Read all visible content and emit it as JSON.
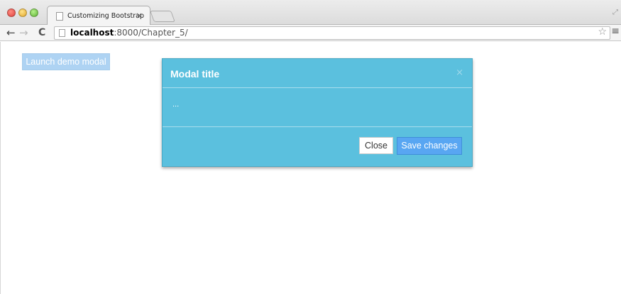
{
  "browser": {
    "tab_title": "Customizing Bootstrap",
    "tab_close": "×",
    "url_host": "localhost",
    "url_rest": ":8000/Chapter_5/"
  },
  "icons": {
    "back": "←",
    "forward": "→",
    "reload": "C",
    "star": "☆",
    "menu": "≡",
    "expand": "⤢"
  },
  "page": {
    "launch_button": "Launch demo modal",
    "modal": {
      "title": "Modal title",
      "close_x": "×",
      "body": "...",
      "close_button": "Close",
      "save_button": "Save changes"
    }
  },
  "colors": {
    "modal_bg": "#5bc0de",
    "primary_button": "#58a6f2",
    "launch_button": "#aed3f3"
  }
}
